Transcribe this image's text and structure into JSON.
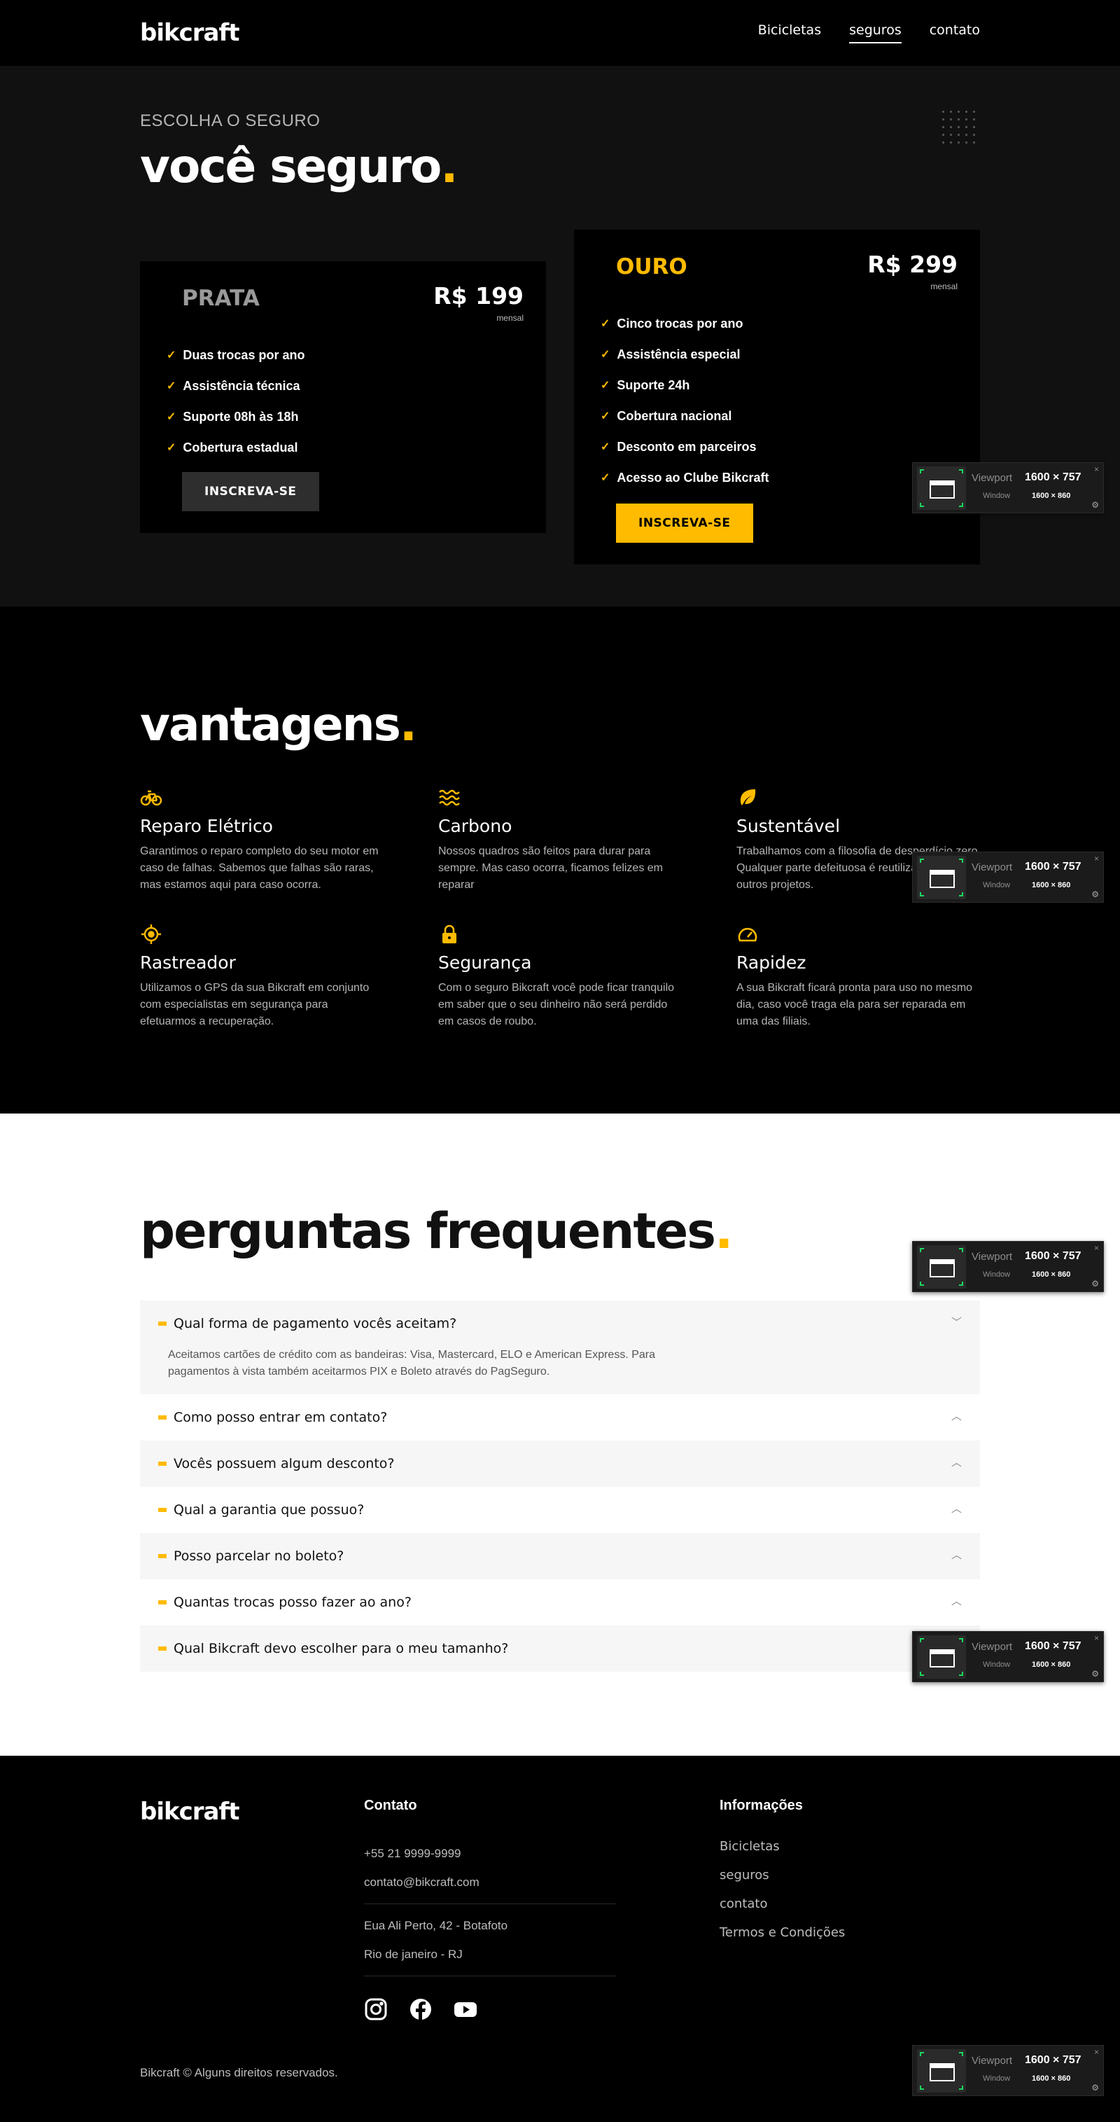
{
  "header": {
    "logo": "bikcraft",
    "nav": [
      "Bicicletas",
      "seguros",
      "contato"
    ],
    "active_nav": "seguros"
  },
  "seguros": {
    "eyebrow": "ESCOLHA O SEGURO",
    "title": "você seguro",
    "title_dot": ".",
    "plans": [
      {
        "name": "PRATA",
        "price": "R$ 199",
        "period": "mensal",
        "features": [
          "Duas trocas por ano",
          "Assistência técnica",
          "Suporte 08h às 18h",
          "Cobertura estadual"
        ],
        "button": "INSCREVA-SE"
      },
      {
        "name": "OURO",
        "price": "R$ 299",
        "period": "mensal",
        "features": [
          "Cinco trocas por ano",
          "Assistência especial",
          "Suporte 24h",
          "Cobertura nacional",
          "Desconto em parceiros",
          "Acesso ao Clube Bikcraft"
        ],
        "button": "INSCREVA-SE"
      }
    ]
  },
  "vantagens": {
    "title": "vantagens",
    "title_dot": ".",
    "items": [
      {
        "icon": "bicycle-icon",
        "title": "Reparo Elétrico",
        "text": "Garantimos o reparo completo do seu motor em caso de falhas. Sabemos que falhas são raras, mas estamos aqui para caso ocorra."
      },
      {
        "icon": "waves-icon",
        "title": "Carbono",
        "text": "Nossos quadros são feitos para durar para sempre. Mas caso ocorra, ficamos felizes em reparar"
      },
      {
        "icon": "leaf-icon",
        "title": "Sustentável",
        "text": "Trabalhamos com a filosofia de desperdício zero. Qualquer parte defeituosa é reutilizada em outros projetos."
      },
      {
        "icon": "target-icon",
        "title": "Rastreador",
        "text": "Utilizamos o GPS da sua Bikcraft em conjunto com especialistas em segurança para efetuarmos a recuperação."
      },
      {
        "icon": "lock-icon",
        "title": "Segurança",
        "text": "Com o seguro Bikcraft você pode ficar tranquilo em saber que o seu dinheiro não será perdido em casos de roubo."
      },
      {
        "icon": "speedometer-icon",
        "title": "Rapidez",
        "text": "A sua Bikcraft ficará pronta para uso no mesmo dia, caso você traga ela para ser reparada em uma das filiais."
      }
    ]
  },
  "faq": {
    "title": "perguntas frequentes",
    "title_dot": ".",
    "items": [
      {
        "q": "Qual forma de pagamento vocês aceitam?",
        "a": "Aceitamos cartões de crédito com as bandeiras: Visa, Mastercard, ELO e American Express. Para pagamentos à vista também aceitarmos PIX e Boleto através do PagSeguro.",
        "open": true
      },
      {
        "q": "Como posso entrar em contato?",
        "a": "",
        "open": false
      },
      {
        "q": "Vocês possuem algum desconto?",
        "a": "",
        "open": false
      },
      {
        "q": "Qual a garantia que possuo?",
        "a": "",
        "open": false
      },
      {
        "q": "Posso parcelar no boleto?",
        "a": "",
        "open": false
      },
      {
        "q": "Quantas trocas posso fazer ao ano?",
        "a": "",
        "open": false
      },
      {
        "q": "Qual Bikcraft devo escolher para o meu tamanho?",
        "a": "",
        "open": false
      }
    ]
  },
  "footer": {
    "logo": "bikcraft",
    "contato_title": "Contato",
    "phone": "+55 21 9999-9999",
    "email": "contato@bikcraft.com",
    "address1": "Eua Ali Perto, 42 - Botafoto",
    "address2": "Rio de janeiro - RJ",
    "info_title": "Informações",
    "links": [
      "Bicicletas",
      "seguros",
      "contato",
      "Termos e Condições"
    ],
    "social": [
      "instagram-icon",
      "facebook-icon",
      "youtube-icon"
    ],
    "copyright": "Bikcraft © Alguns direitos reservados."
  },
  "viewport_widget": {
    "viewport_label": "Viewport",
    "viewport_value": "1600 × 757",
    "window_label": "Window",
    "window_value": "1600 × 860",
    "close": "×"
  },
  "colors": {
    "accent": "#ffbb00",
    "dark": "#000000",
    "panel": "#111111"
  }
}
